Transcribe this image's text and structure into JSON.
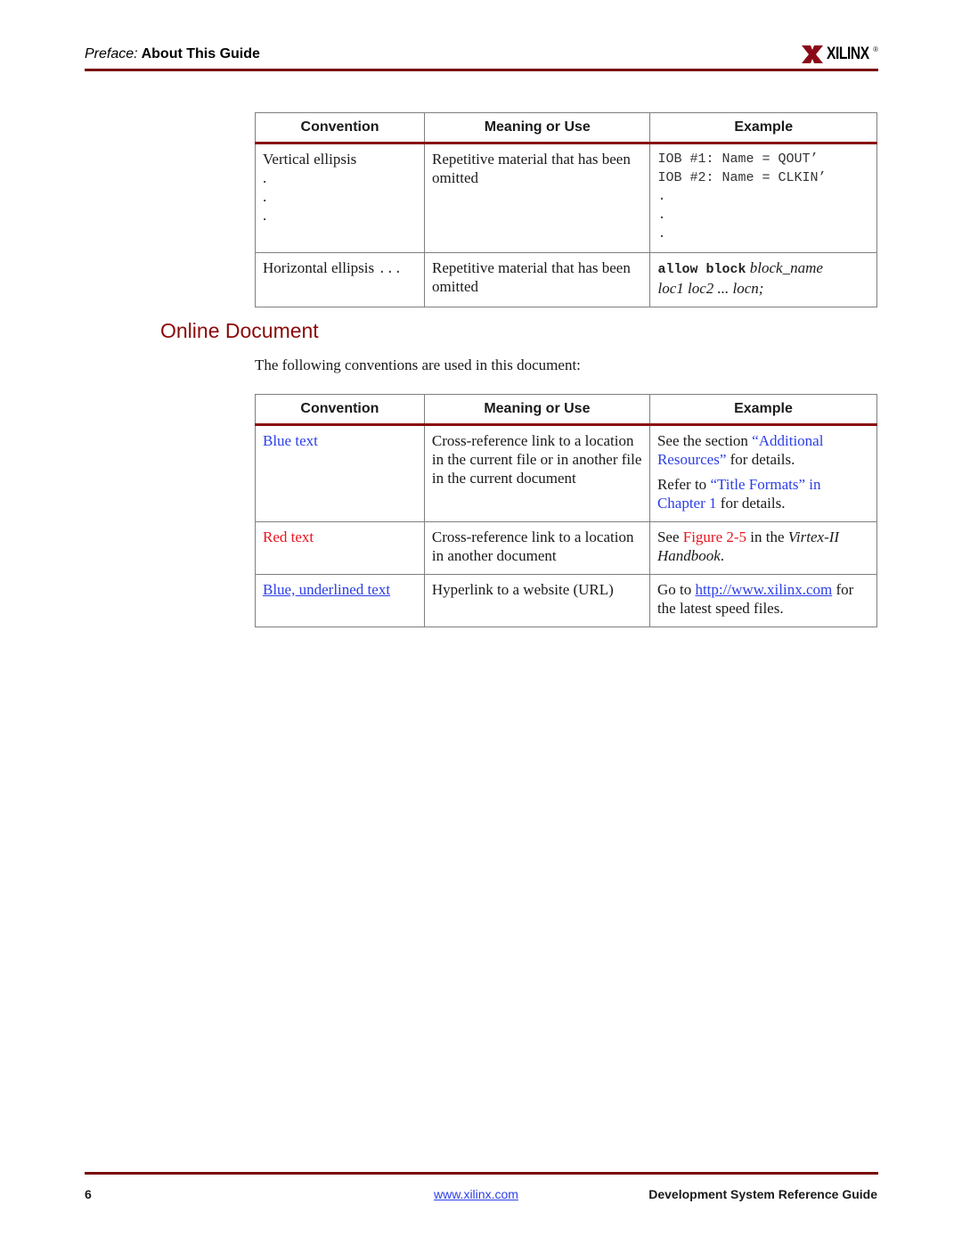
{
  "header": {
    "section_label": "Preface:",
    "section_title": "About This Guide",
    "logo_text": "XILINX",
    "logo_registered": "®"
  },
  "colors": {
    "rule": "#7a0a0a",
    "heading": "#8b0a0a",
    "blue_link": "#2b3ee8",
    "red_link": "#e8141e"
  },
  "table1": {
    "headers": [
      "Convention",
      "Meaning or Use",
      "Example"
    ],
    "rows": [
      {
        "convention": "Vertical ellipsis",
        "convention_dots": [
          ".",
          ".",
          "."
        ],
        "meaning": "Repetitive material that has been omitted",
        "example_lines": [
          "IOB #1: Name = QOUT’",
          "IOB #2: Name = CLKIN’"
        ],
        "example_dots": [
          ".",
          ".",
          "."
        ]
      },
      {
        "convention": "Horizontal ellipsis",
        "convention_suffix": "...",
        "meaning": "Repetitive material that has been omitted",
        "example_code": "allow block",
        "example_italic": "block_name",
        "example_line2": "loc1 loc2 ... locn;"
      }
    ]
  },
  "section": {
    "heading": "Online Document",
    "intro": "The following conventions are used in this document:"
  },
  "table2": {
    "headers": [
      "Convention",
      "Meaning or Use",
      "Example"
    ],
    "rows": [
      {
        "convention": "Blue text",
        "meaning": "Cross-reference link to a location in the current file or in another file in the current document",
        "example1_prefix": "See the section ",
        "example1_link": "“Additional Resources”",
        "example1_suffix": " for details.",
        "example2_prefix": "Refer to ",
        "example2_link": "“Title Formats” in Chapter 1",
        "example2_suffix": " for details."
      },
      {
        "convention": "Red text",
        "meaning": "Cross-reference link to a location in another document",
        "example_prefix": "See ",
        "example_link": "Figure 2-5",
        "example_middle": " in the ",
        "example_italic": "Virtex-II Handbook",
        "example_suffix": "."
      },
      {
        "convention": "Blue, underlined text",
        "meaning": "Hyperlink to a website (URL)",
        "example_prefix": "Go to ",
        "example_link": "http://www.xilinx.com",
        "example_suffix": " for the latest speed files."
      }
    ]
  },
  "footer": {
    "page_number": "6",
    "website": "www.xilinx.com",
    "doc_title": "Development System Reference Guide"
  }
}
